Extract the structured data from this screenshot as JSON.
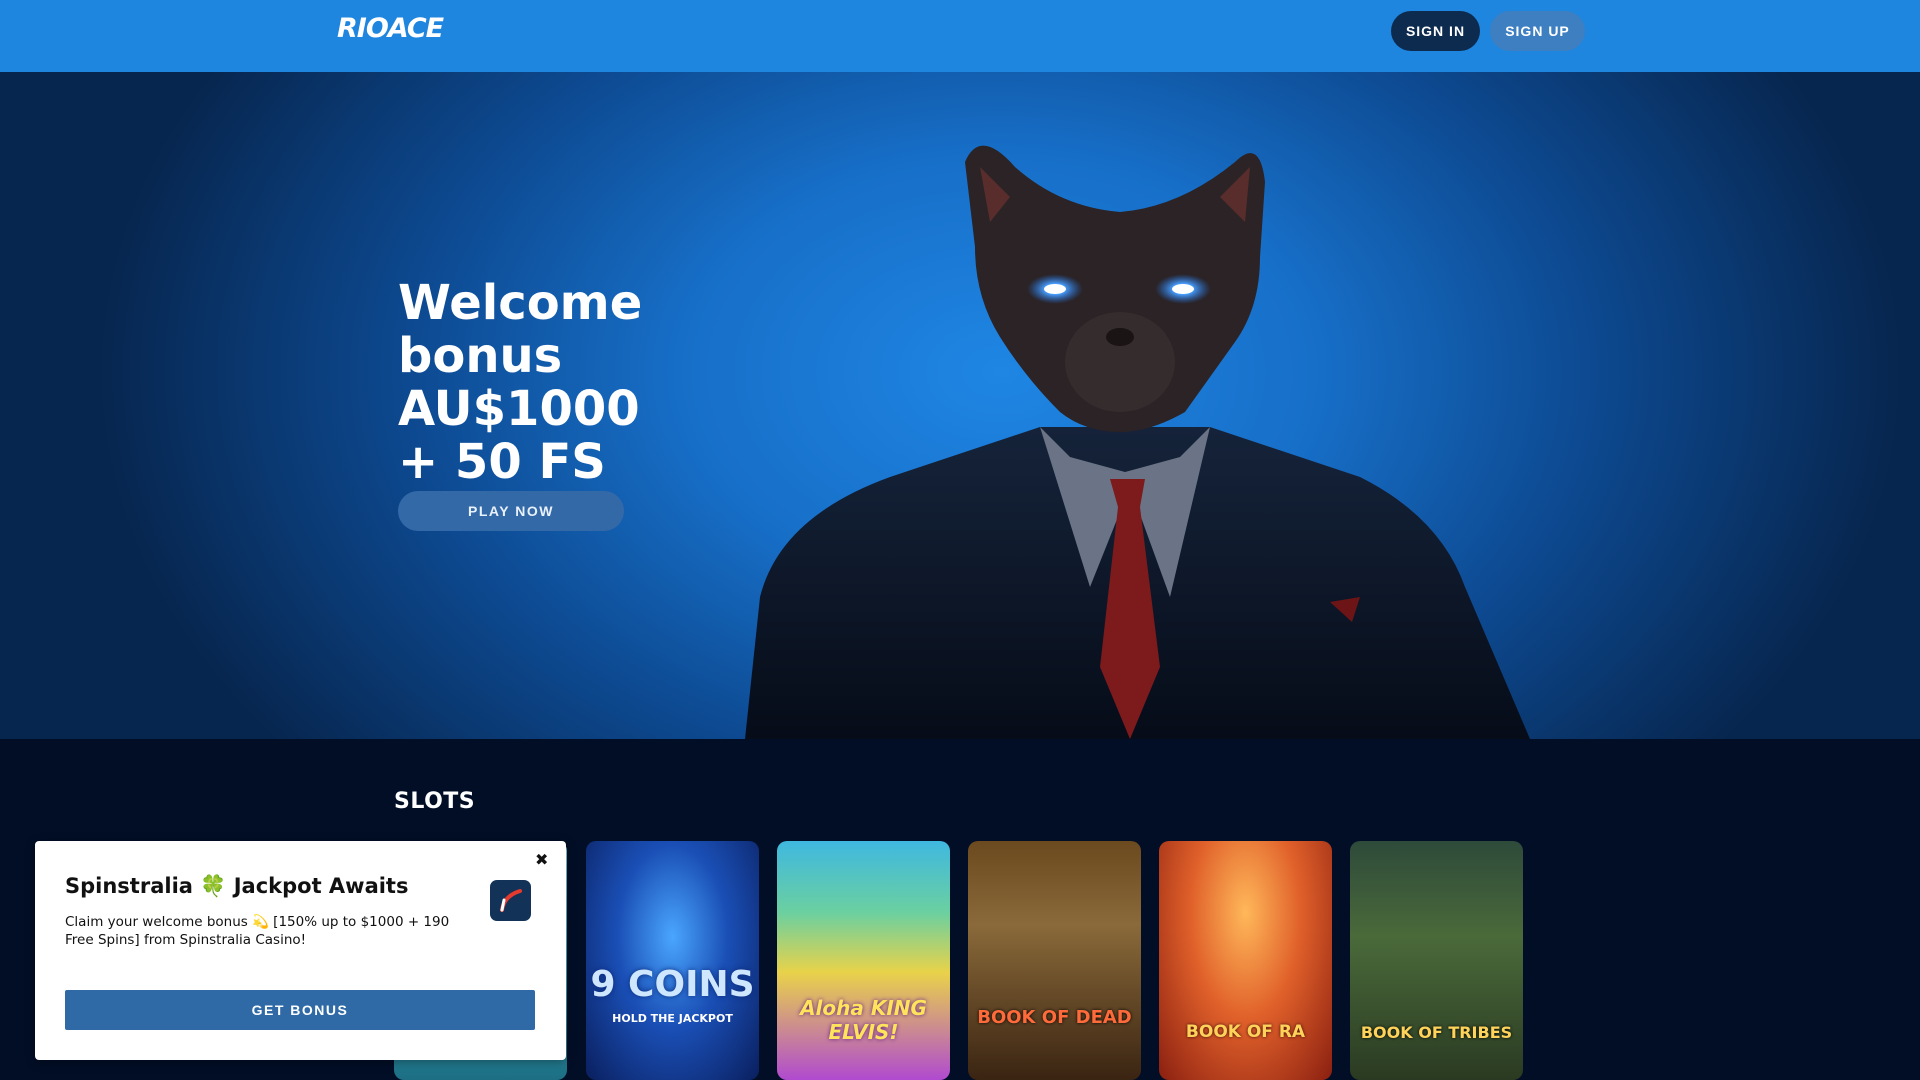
{
  "header": {
    "logo_text": "RIOACE",
    "signin_label": "SIGN IN",
    "signup_label": "SIGN UP"
  },
  "hero": {
    "title": "Welcome bonus AU$1000 + 50 FS",
    "play_label": "PLAY NOW"
  },
  "slots": {
    "title": "SLOTS",
    "games": [
      {
        "title": "9 COINS",
        "subtitle": "HOLD THE JACKPOT"
      },
      {
        "title": "Aloha KING ELVIS!"
      },
      {
        "title": "BOOK OF DEAD"
      },
      {
        "title": "BOOK OF RA"
      },
      {
        "title": "BOOK OF TRIBES"
      }
    ]
  },
  "popup": {
    "close_glyph": "✖",
    "title": "Spinstralia 🍀 Jackpot Awaits",
    "text": "Claim your welcome bonus 💫 [150% up to $1000 + 190 Free Spins] from Spinstralia Casino!",
    "button_label": "GET BONUS"
  },
  "colors": {
    "header_bg": "#1f86df",
    "signin_bg": "#0d2b4f",
    "signup_bg": "#3d7fc0",
    "page_bg": "#020e26",
    "popup_button": "#2f6aa7"
  }
}
